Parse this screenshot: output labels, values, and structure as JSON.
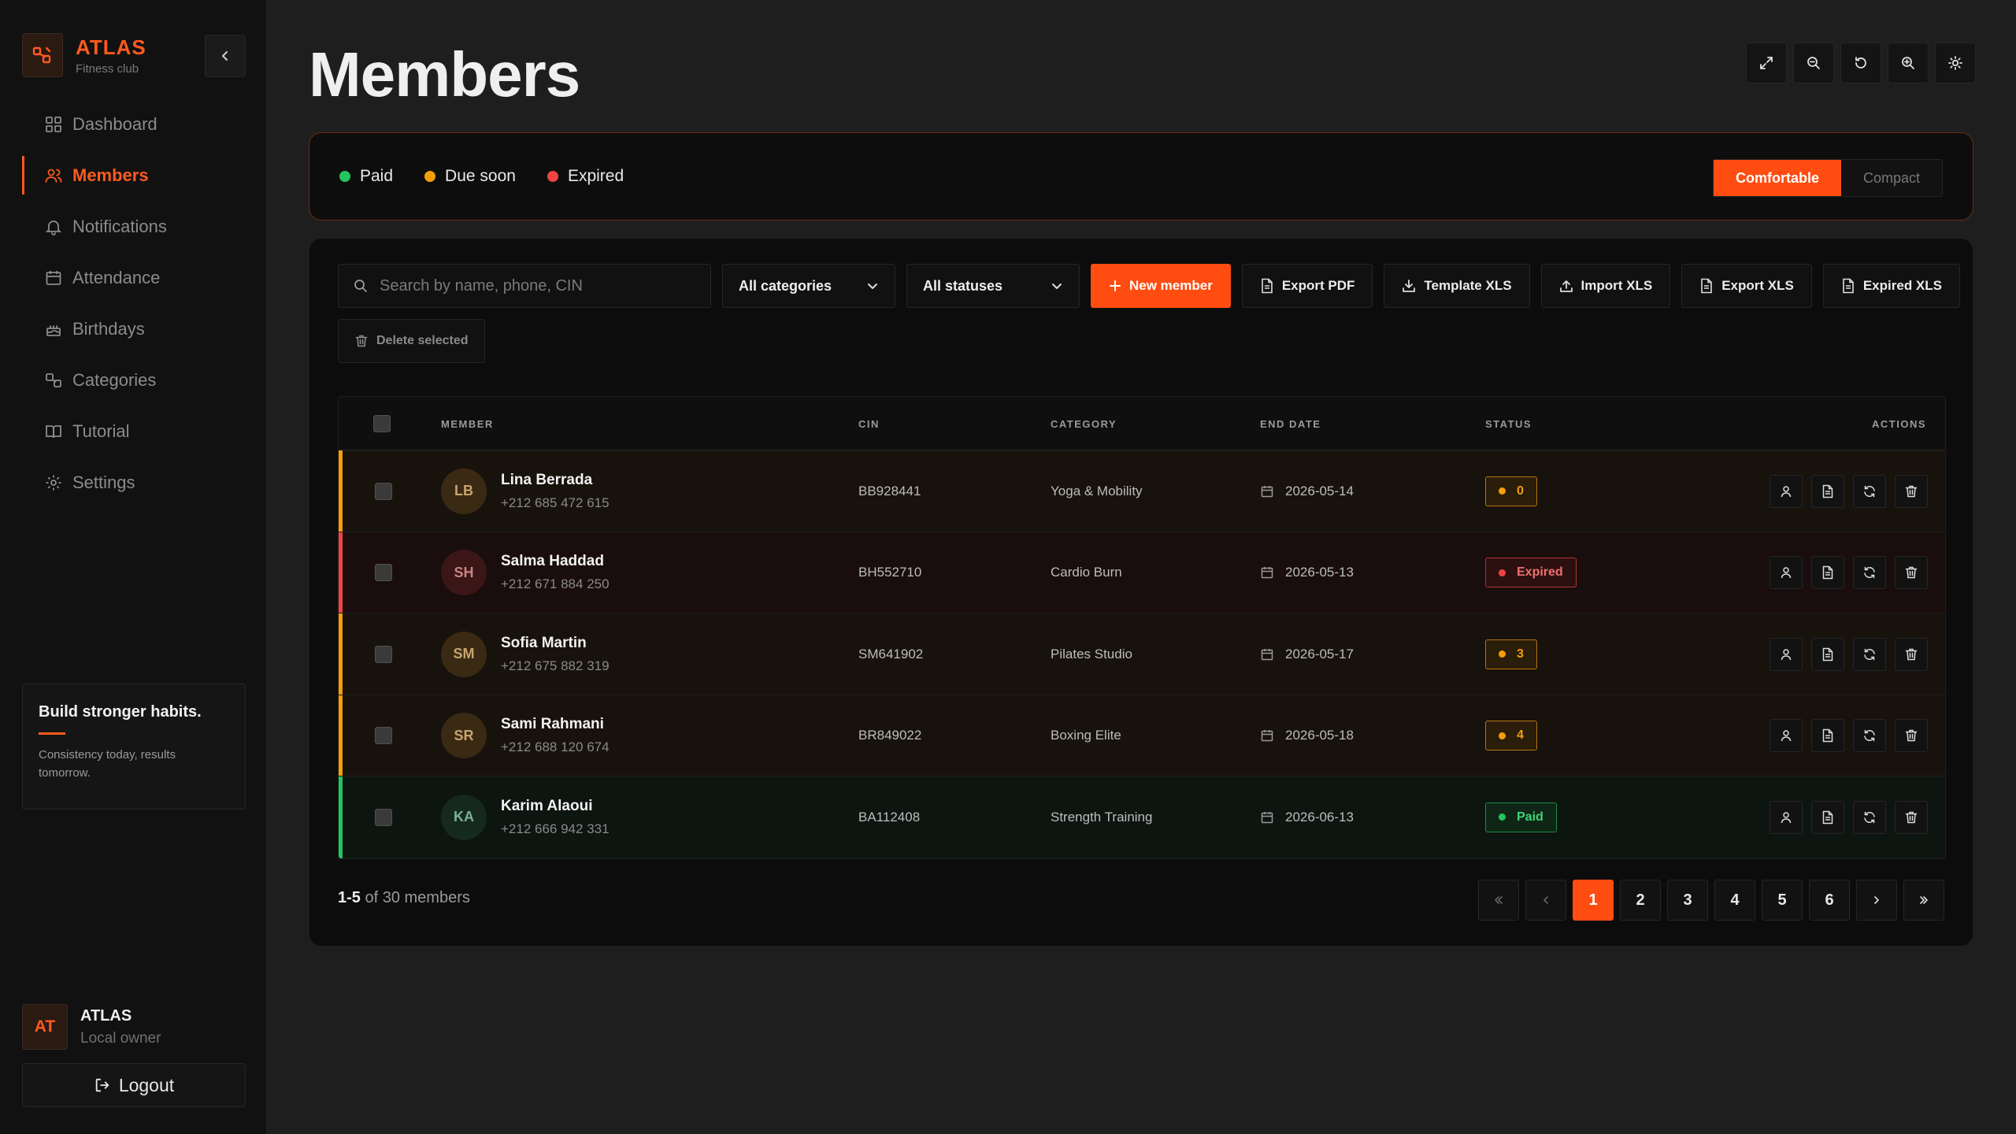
{
  "brand": {
    "name": "ATLAS",
    "subtitle": "Fitness club"
  },
  "sidebar": {
    "items": [
      {
        "label": "Dashboard",
        "icon": "dashboard-icon",
        "active": false
      },
      {
        "label": "Members",
        "icon": "members-icon",
        "active": true
      },
      {
        "label": "Notifications",
        "icon": "bell-icon",
        "active": false
      },
      {
        "label": "Attendance",
        "icon": "calendar-icon",
        "active": false
      },
      {
        "label": "Birthdays",
        "icon": "cake-icon",
        "active": false
      },
      {
        "label": "Categories",
        "icon": "categories-icon",
        "active": false
      },
      {
        "label": "Tutorial",
        "icon": "book-icon",
        "active": false
      },
      {
        "label": "Settings",
        "icon": "gear-icon",
        "active": false
      }
    ],
    "quote": {
      "title": "Build stronger habits.",
      "text": "Consistency today, results tomorrow."
    },
    "owner": {
      "initials": "AT",
      "name": "ATLAS",
      "role": "Local owner"
    },
    "logout_label": "Logout"
  },
  "page": {
    "title": "Members"
  },
  "legend": {
    "items": [
      {
        "label": "Paid",
        "color": "#22c55e"
      },
      {
        "label": "Due soon",
        "color": "#f59e0b"
      },
      {
        "label": "Expired",
        "color": "#ef4444"
      }
    ],
    "density": {
      "selected": "Comfortable",
      "other": "Compact"
    }
  },
  "toolbar": {
    "search_placeholder": "Search by name, phone, CIN",
    "category_select": "All categories",
    "status_select": "All statuses",
    "new_member": "New member",
    "export_pdf": "Export PDF",
    "template_xls": "Template XLS",
    "import_xls": "Import XLS",
    "export_xls": "Export XLS",
    "expired_xls": "Expired XLS",
    "delete_selected": "Delete selected"
  },
  "table": {
    "headers": {
      "member": "MEMBER",
      "cin": "CIN",
      "category": "CATEGORY",
      "end_date": "END DATE",
      "status": "STATUS",
      "actions": "ACTIONS"
    },
    "rows": [
      {
        "initials": "LB",
        "name": "Lina Berrada",
        "phone": "+212 685 472 615",
        "cin": "BB928441",
        "category": "Yoga & Mobility",
        "end_date": "2026-05-14",
        "status": "0",
        "status_type": "due"
      },
      {
        "initials": "SH",
        "name": "Salma Haddad",
        "phone": "+212 671 884 250",
        "cin": "BH552710",
        "category": "Cardio Burn",
        "end_date": "2026-05-13",
        "status": "Expired",
        "status_type": "expired"
      },
      {
        "initials": "SM",
        "name": "Sofia Martin",
        "phone": "+212 675 882 319",
        "cin": "SM641902",
        "category": "Pilates Studio",
        "end_date": "2026-05-17",
        "status": "3",
        "status_type": "due"
      },
      {
        "initials": "SR",
        "name": "Sami Rahmani",
        "phone": "+212 688 120 674",
        "cin": "BR849022",
        "category": "Boxing Elite",
        "end_date": "2026-05-18",
        "status": "4",
        "status_type": "due"
      },
      {
        "initials": "KA",
        "name": "Karim Alaoui",
        "phone": "+212 666 942 331",
        "cin": "BA112408",
        "category": "Strength Training",
        "end_date": "2026-06-13",
        "status": "Paid",
        "status_type": "paid"
      }
    ]
  },
  "pagination": {
    "range": "1-5",
    "total_text": "of 30 members",
    "pages": [
      "1",
      "2",
      "3",
      "4",
      "5",
      "6"
    ],
    "current": "1"
  },
  "colors": {
    "accent": "#ff4d12",
    "paid": "#22c55e",
    "due": "#f59e0b",
    "expired": "#ef4444"
  }
}
